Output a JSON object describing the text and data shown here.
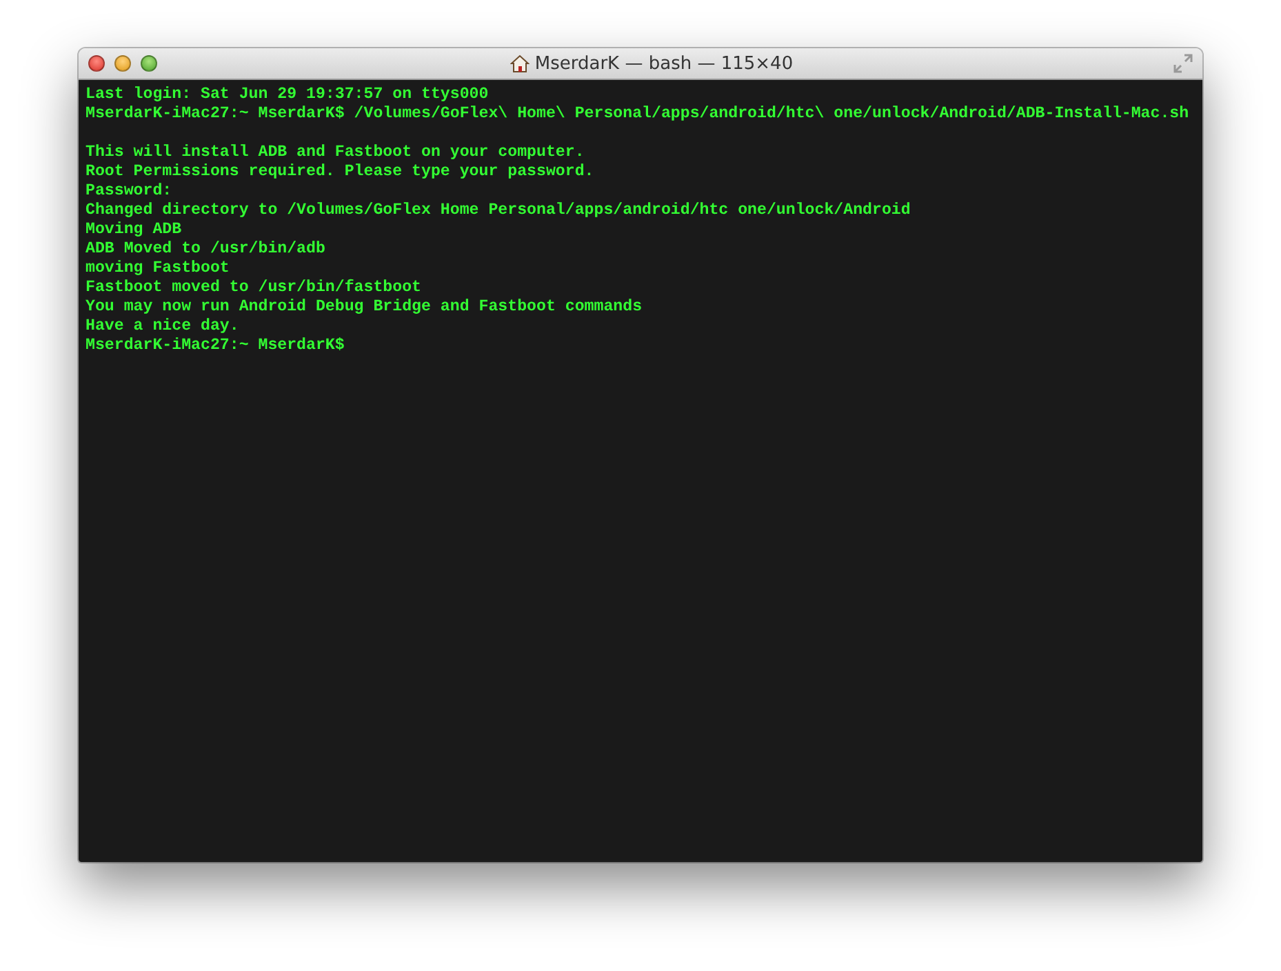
{
  "window": {
    "title": "MserdarK — bash — 115×40"
  },
  "terminal": {
    "lines": [
      {
        "kind": "text",
        "text": "Last login: Sat Jun 29 19:37:57 on ttys000"
      },
      {
        "kind": "text",
        "text": "MserdarK-iMac27:~ MserdarK$ /Volumes/GoFlex\\ Home\\ Personal/apps/android/htc\\ one/unlock/Android/ADB-Install-Mac.sh"
      },
      {
        "kind": "blank"
      },
      {
        "kind": "text",
        "text": "This will install ADB and Fastboot on your computer."
      },
      {
        "kind": "text",
        "text": "Root Permissions required. Please type your password."
      },
      {
        "kind": "text",
        "text": "Password:"
      },
      {
        "kind": "text",
        "text": "Changed directory to /Volumes/GoFlex Home Personal/apps/android/htc one/unlock/Android"
      },
      {
        "kind": "text",
        "text": "Moving ADB"
      },
      {
        "kind": "text",
        "text": "ADB Moved to /usr/bin/adb"
      },
      {
        "kind": "text",
        "text": "moving Fastboot"
      },
      {
        "kind": "text",
        "text": "Fastboot moved to /usr/bin/fastboot"
      },
      {
        "kind": "text",
        "text": "You may now run Android Debug Bridge and Fastboot commands"
      },
      {
        "kind": "text",
        "text": "Have a nice day."
      },
      {
        "kind": "text",
        "text": "MserdarK-iMac27:~ MserdarK$"
      }
    ]
  }
}
